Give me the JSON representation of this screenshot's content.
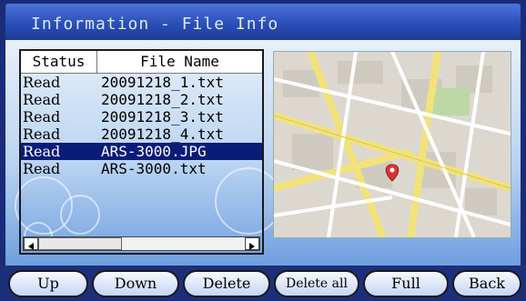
{
  "window": {
    "title": "Information - File Info"
  },
  "file_list": {
    "columns": [
      "Status",
      "File Name"
    ],
    "rows": [
      {
        "status": "Read",
        "file_name": "20091218_1.txt",
        "selected": false
      },
      {
        "status": "Read",
        "file_name": "20091218_2.txt",
        "selected": false
      },
      {
        "status": "Read",
        "file_name": "20091218_3.txt",
        "selected": false
      },
      {
        "status": "Read",
        "file_name": "20091218_4.txt",
        "selected": false
      },
      {
        "status": "Read",
        "file_name": "ARS-3000.JPG",
        "selected": true
      },
      {
        "status": "Read",
        "file_name": "ARS-3000.txt",
        "selected": false
      }
    ]
  },
  "buttons": {
    "up": "Up",
    "down": "Down",
    "delete": "Delete",
    "delete_all": "Delete all",
    "full": "Full",
    "back": "Back"
  },
  "colors": {
    "selection": "#0b1c78",
    "frame": "#1a2c78",
    "map_road": "#f2e27a"
  }
}
